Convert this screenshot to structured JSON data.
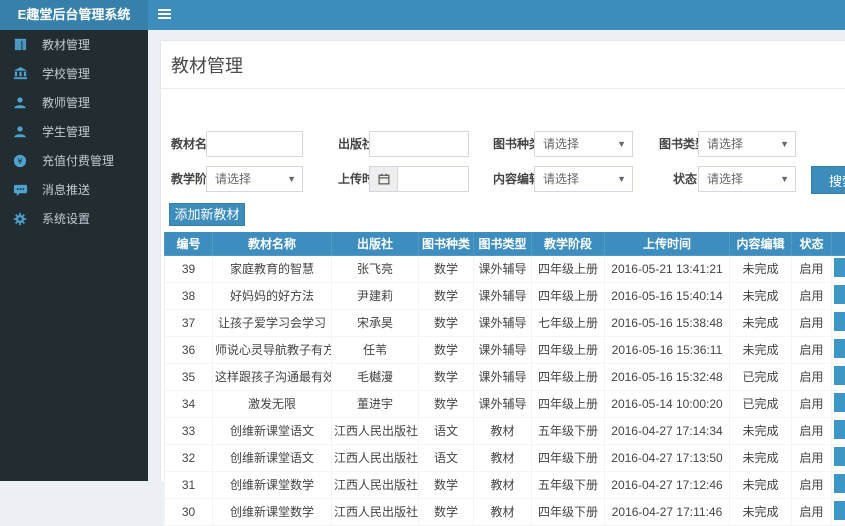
{
  "app": {
    "title": "E趣堂后台管理系统"
  },
  "topbar": {
    "menu_icon": "hamburger-icon"
  },
  "sidebar": {
    "items": [
      {
        "icon": "book-icon",
        "label": "教材管理"
      },
      {
        "icon": "bank-icon",
        "label": "学校管理"
      },
      {
        "icon": "teacher-icon",
        "label": "教师管理"
      },
      {
        "icon": "student-icon",
        "label": "学生管理"
      },
      {
        "icon": "recharge-icon",
        "label": "充值付费管理"
      },
      {
        "icon": "message-icon",
        "label": "消息推送"
      },
      {
        "icon": "gear-icon",
        "label": "系统设置"
      }
    ]
  },
  "page": {
    "title": "教材管理"
  },
  "filters": {
    "material_name_label": "教材名称",
    "publisher_label": "出版社",
    "book_category_label": "图书种类",
    "book_type_label": "图书类型",
    "teaching_stage_label": "教学阶段",
    "upload_time_label": "上传时间",
    "content_edit_label": "内容编辑",
    "status_label": "状态",
    "select_placeholder": "请选择",
    "search_button": "搜索"
  },
  "toolbar": {
    "add_button": "添加新教材"
  },
  "table": {
    "columns": [
      "编号",
      "教材名称",
      "出版社",
      "图书种类",
      "图书类型",
      "教学阶段",
      "上传时间",
      "内容编辑",
      "状态"
    ],
    "rows": [
      [
        "39",
        "家庭教育的智慧",
        "张飞亮",
        "数学",
        "课外辅导",
        "四年级上册",
        "2016-05-21 13:41:21",
        "未完成",
        "启用"
      ],
      [
        "38",
        "好妈妈的好方法",
        "尹建莉",
        "数学",
        "课外辅导",
        "四年级上册",
        "2016-05-16 15:40:14",
        "未完成",
        "启用"
      ],
      [
        "37",
        "让孩子爱学习会学习",
        "宋承昊",
        "数学",
        "课外辅导",
        "七年级上册",
        "2016-05-16 15:38:48",
        "未完成",
        "启用"
      ],
      [
        "36",
        "师说心灵导航教子有方",
        "任苇",
        "数学",
        "课外辅导",
        "四年级上册",
        "2016-05-16 15:36:11",
        "未完成",
        "启用"
      ],
      [
        "35",
        "这样跟孩子沟通最有效",
        "毛樾漫",
        "数学",
        "课外辅导",
        "四年级上册",
        "2016-05-16 15:32:48",
        "已完成",
        "启用"
      ],
      [
        "34",
        "激发无限",
        "董进宇",
        "数学",
        "课外辅导",
        "四年级上册",
        "2016-05-14 10:00:20",
        "已完成",
        "启用"
      ],
      [
        "33",
        "创维新课堂语文",
        "江西人民出版社",
        "语文",
        "教材",
        "五年级下册",
        "2016-04-27 17:14:34",
        "未完成",
        "启用"
      ],
      [
        "32",
        "创维新课堂语文",
        "江西人民出版社",
        "语文",
        "教材",
        "四年级下册",
        "2016-04-27 17:13:50",
        "未完成",
        "启用"
      ],
      [
        "31",
        "创维新课堂数学",
        "江西人民出版社",
        "数学",
        "教材",
        "五年级下册",
        "2016-04-27 17:12:46",
        "未完成",
        "启用"
      ],
      [
        "30",
        "创维新课堂数学",
        "江西人民出版社",
        "数学",
        "教材",
        "四年级下册",
        "2016-04-27 17:11:46",
        "未完成",
        "启用"
      ]
    ]
  },
  "colors": {
    "navbar": "#3c8dbc",
    "logo_bg": "#3780ab",
    "sidebar_bg": "#222d32",
    "sidebar_icon": "#4ea2d0",
    "sidebar_text": "#c1cbd1",
    "table_header_bg": "#3d8ebf",
    "accent": "#3c8dbc",
    "page_bg": "#ecf0f5"
  }
}
